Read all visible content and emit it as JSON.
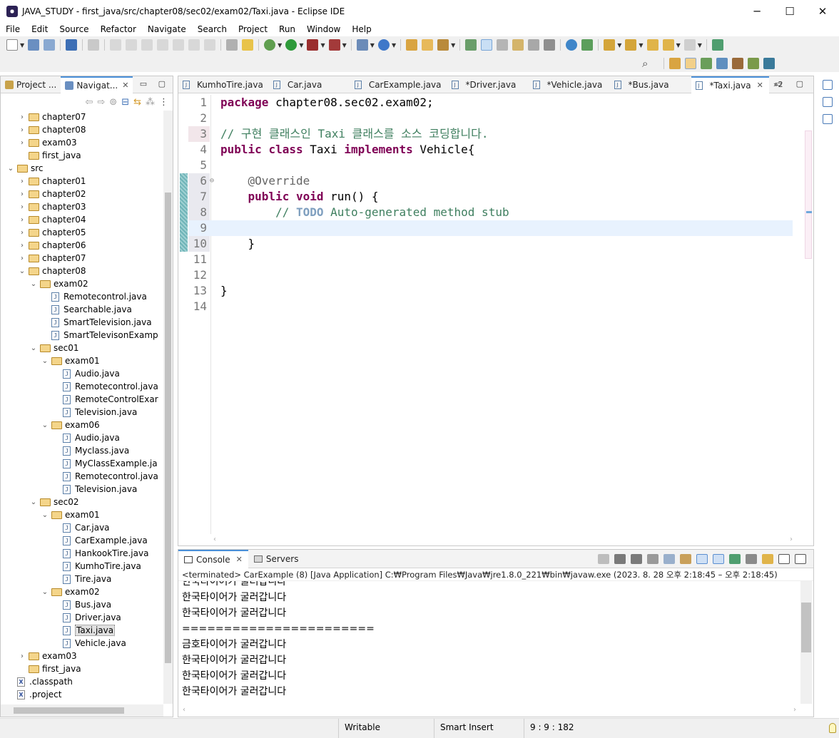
{
  "window": {
    "title": "JAVA_STUDY - first_java/src/chapter08/sec02/exam02/Taxi.java - Eclipse IDE",
    "minimize_glyph": "─",
    "maximize_glyph": "☐",
    "close_glyph": "✕"
  },
  "menu": [
    "File",
    "Edit",
    "Source",
    "Refactor",
    "Navigate",
    "Search",
    "Project",
    "Run",
    "Window",
    "Help"
  ],
  "left_panel": {
    "tabs": [
      {
        "label": "Project ...",
        "active": false
      },
      {
        "label": "Navigat...",
        "active": true,
        "close": "✕"
      }
    ],
    "tree": [
      {
        "indent": 2,
        "twisty": "›",
        "kind": "folder",
        "label": "chapter07"
      },
      {
        "indent": 2,
        "twisty": "›",
        "kind": "folder",
        "label": "chapter08"
      },
      {
        "indent": 2,
        "twisty": "›",
        "kind": "folder",
        "label": "exam03"
      },
      {
        "indent": 2,
        "twisty": "",
        "kind": "folder",
        "label": "first_java"
      },
      {
        "indent": 1,
        "twisty": "⌄",
        "kind": "folder",
        "label": "src"
      },
      {
        "indent": 2,
        "twisty": "›",
        "kind": "folder",
        "label": "chapter01"
      },
      {
        "indent": 2,
        "twisty": "›",
        "kind": "folder",
        "label": "chapter02"
      },
      {
        "indent": 2,
        "twisty": "›",
        "kind": "folder",
        "label": "chapter03"
      },
      {
        "indent": 2,
        "twisty": "›",
        "kind": "folder",
        "label": "chapter04"
      },
      {
        "indent": 2,
        "twisty": "›",
        "kind": "folder",
        "label": "chapter05"
      },
      {
        "indent": 2,
        "twisty": "›",
        "kind": "folder",
        "label": "chapter06"
      },
      {
        "indent": 2,
        "twisty": "›",
        "kind": "folder",
        "label": "chapter07"
      },
      {
        "indent": 2,
        "twisty": "⌄",
        "kind": "folder",
        "label": "chapter08"
      },
      {
        "indent": 3,
        "twisty": "⌄",
        "kind": "folder",
        "label": "exam02"
      },
      {
        "indent": 4,
        "twisty": "",
        "kind": "java",
        "label": "Remotecontrol.java"
      },
      {
        "indent": 4,
        "twisty": "",
        "kind": "java",
        "label": "Searchable.java"
      },
      {
        "indent": 4,
        "twisty": "",
        "kind": "java",
        "label": "SmartTelevision.java"
      },
      {
        "indent": 4,
        "twisty": "",
        "kind": "java",
        "label": "SmartTelevisonExamp"
      },
      {
        "indent": 3,
        "twisty": "⌄",
        "kind": "folder",
        "label": "sec01"
      },
      {
        "indent": 4,
        "twisty": "⌄",
        "kind": "folder",
        "label": "exam01"
      },
      {
        "indent": 5,
        "twisty": "",
        "kind": "java",
        "label": "Audio.java"
      },
      {
        "indent": 5,
        "twisty": "",
        "kind": "java",
        "label": "Remotecontrol.java"
      },
      {
        "indent": 5,
        "twisty": "",
        "kind": "java",
        "label": "RemoteControlExar"
      },
      {
        "indent": 5,
        "twisty": "",
        "kind": "java",
        "label": "Television.java"
      },
      {
        "indent": 4,
        "twisty": "⌄",
        "kind": "folder",
        "label": "exam06"
      },
      {
        "indent": 5,
        "twisty": "",
        "kind": "java",
        "label": "Audio.java"
      },
      {
        "indent": 5,
        "twisty": "",
        "kind": "java",
        "label": "Myclass.java"
      },
      {
        "indent": 5,
        "twisty": "",
        "kind": "java",
        "label": "MyClassExample.ja"
      },
      {
        "indent": 5,
        "twisty": "",
        "kind": "java",
        "label": "Remotecontrol.java"
      },
      {
        "indent": 5,
        "twisty": "",
        "kind": "java",
        "label": "Television.java"
      },
      {
        "indent": 3,
        "twisty": "⌄",
        "kind": "folder",
        "label": "sec02"
      },
      {
        "indent": 4,
        "twisty": "⌄",
        "kind": "folder",
        "label": "exam01"
      },
      {
        "indent": 5,
        "twisty": "",
        "kind": "java",
        "label": "Car.java"
      },
      {
        "indent": 5,
        "twisty": "",
        "kind": "java",
        "label": "CarExample.java"
      },
      {
        "indent": 5,
        "twisty": "",
        "kind": "java",
        "label": "HankookTire.java"
      },
      {
        "indent": 5,
        "twisty": "",
        "kind": "java",
        "label": "KumhoTire.java"
      },
      {
        "indent": 5,
        "twisty": "",
        "kind": "java",
        "label": "Tire.java"
      },
      {
        "indent": 4,
        "twisty": "⌄",
        "kind": "folder",
        "label": "exam02"
      },
      {
        "indent": 5,
        "twisty": "",
        "kind": "java",
        "label": "Bus.java"
      },
      {
        "indent": 5,
        "twisty": "",
        "kind": "java",
        "label": "Driver.java"
      },
      {
        "indent": 5,
        "twisty": "",
        "kind": "java",
        "label": "Taxi.java",
        "selected": true
      },
      {
        "indent": 5,
        "twisty": "",
        "kind": "java",
        "label": "Vehicle.java"
      },
      {
        "indent": 2,
        "twisty": "›",
        "kind": "folder",
        "label": "exam03"
      },
      {
        "indent": 2,
        "twisty": "",
        "kind": "folder",
        "label": "first_java"
      },
      {
        "indent": 1,
        "twisty": "",
        "kind": "xml",
        "label": ".classpath"
      },
      {
        "indent": 1,
        "twisty": "",
        "kind": "xml",
        "label": ".project"
      }
    ]
  },
  "editor": {
    "tabs": [
      {
        "label": "KumhoTire.java",
        "active": false
      },
      {
        "label": "Car.java",
        "active": false
      },
      {
        "label": "CarExample.java",
        "active": false
      },
      {
        "label": "*Driver.java",
        "active": false
      },
      {
        "label": "*Vehicle.java",
        "active": false
      },
      {
        "label": "*Bus.java",
        "active": false
      },
      {
        "label": "*Taxi.java",
        "active": true
      }
    ],
    "overflow_label": "»2",
    "lines": [
      {
        "n": "1",
        "tokens": [
          {
            "t": "package",
            "c": "kw"
          },
          {
            "t": " chapter08.sec02.exam02;",
            "c": ""
          }
        ]
      },
      {
        "n": "2",
        "tokens": []
      },
      {
        "n": "3",
        "tokens": [
          {
            "t": "// 구현 클래스인 Taxi 클래스를 소스 코딩합니다.",
            "c": "cm"
          }
        ],
        "mark": "hl3"
      },
      {
        "n": "4",
        "tokens": [
          {
            "t": "public",
            "c": "kw"
          },
          {
            "t": " ",
            "c": ""
          },
          {
            "t": "class",
            "c": "kw"
          },
          {
            "t": " Taxi ",
            "c": ""
          },
          {
            "t": "implements",
            "c": "kw"
          },
          {
            "t": " Vehicle{",
            "c": ""
          }
        ]
      },
      {
        "n": "5",
        "tokens": []
      },
      {
        "n": "6",
        "fold": "⊖",
        "tokens": [
          {
            "t": "    ",
            "c": ""
          },
          {
            "t": "@Override",
            "c": "an"
          }
        ],
        "mark": "gutterbar"
      },
      {
        "n": "7",
        "tokens": [
          {
            "t": "    ",
            "c": ""
          },
          {
            "t": "public",
            "c": "kw"
          },
          {
            "t": " ",
            "c": ""
          },
          {
            "t": "void",
            "c": "kw"
          },
          {
            "t": " run() {",
            "c": ""
          }
        ],
        "mark": "gutterbar"
      },
      {
        "n": "8",
        "tokens": [
          {
            "t": "        ",
            "c": ""
          },
          {
            "t": "// ",
            "c": "cm"
          },
          {
            "t": "TODO",
            "c": "todo"
          },
          {
            "t": " Auto-generated method stub",
            "c": "cm"
          }
        ],
        "mark": "gutterbar"
      },
      {
        "n": "9",
        "tokens": [],
        "mark": "current"
      },
      {
        "n": "10",
        "tokens": [
          {
            "t": "    }",
            "c": ""
          }
        ],
        "mark": "gutterbar"
      },
      {
        "n": "11",
        "tokens": []
      },
      {
        "n": "12",
        "tokens": []
      },
      {
        "n": "13",
        "tokens": [
          {
            "t": "}",
            "c": ""
          }
        ]
      },
      {
        "n": "14",
        "tokens": []
      }
    ]
  },
  "console": {
    "tabs": [
      {
        "label": "Console",
        "active": true,
        "close": "✕"
      },
      {
        "label": "Servers",
        "active": false
      }
    ],
    "status": "<terminated> CarExample (8) [Java Application] C:₩Program Files₩Java₩jre1.8.0_221₩bin₩javaw.exe  (2023. 8. 28 오후 2:18:45 – 오후 2:18:45)",
    "output": [
      "한국타이어가 굴러갑니다",
      "한국타이어가 굴러갑니다",
      "한국타이어가 굴러갑니다",
      "=======================",
      "금호타이어가 굴러갑니다",
      "한국타이어가 굴러갑니다",
      "한국타이어가 굴러갑니다",
      "한국타이어가 굴러갑니다"
    ]
  },
  "statusbar": {
    "writable": "Writable",
    "insert_mode": "Smart Insert",
    "position": "9 : 9 : 182"
  },
  "colors": {
    "keyword": "#7f0055",
    "comment": "#3f7f5f",
    "todo": "#7f9fbf",
    "annotation": "#646464",
    "current_line": "#e8f2fe",
    "tab_accent": "#4a90d9"
  }
}
